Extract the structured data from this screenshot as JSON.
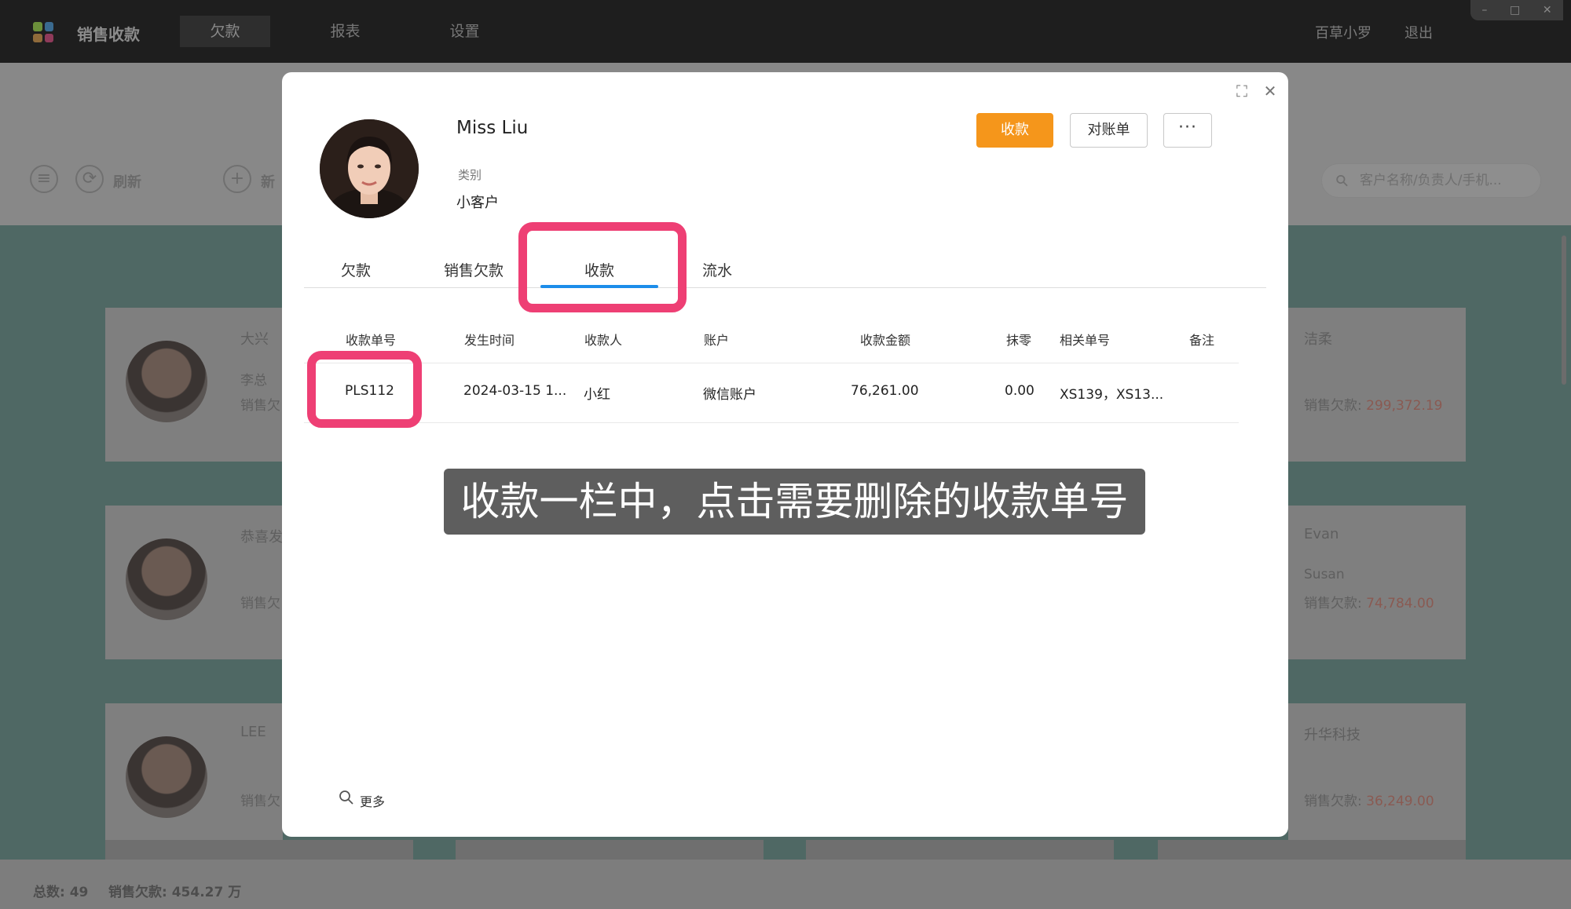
{
  "app": {
    "title": "销售收款",
    "nav": [
      {
        "label": "欠款",
        "active": true
      },
      {
        "label": "报表",
        "active": false
      },
      {
        "label": "设置",
        "active": false
      }
    ],
    "user": "百草小罗",
    "logout": "退出"
  },
  "toolbar": {
    "refresh_label": "刷新",
    "new_label": "新",
    "search_placeholder": "客户名称/负责人/手机..."
  },
  "background_cards": [
    {
      "name": "大兴",
      "line2": "李总",
      "line3": "销售欠"
    },
    {
      "name": "恭喜发",
      "line3": "销售欠"
    },
    {
      "name": "LEE",
      "line3": "销售欠"
    }
  ],
  "background_cards_right": [
    {
      "name": "洁柔",
      "debt_label": "销售欠款:",
      "debt_value": "299,372.19"
    },
    {
      "name": "Evan",
      "line2": "Susan",
      "debt_label": "销售欠款:",
      "debt_value": "74,784.00"
    },
    {
      "name": "升华科技",
      "debt_label": "销售欠款:",
      "debt_value": "36,249.00"
    }
  ],
  "status": {
    "total": "总数:  49",
    "sales_debt": "销售欠款:  454.27 万"
  },
  "modal": {
    "customer_name": "Miss Liu",
    "category_label": "类别",
    "category_value": "小客户",
    "buttons": {
      "collect": "收款",
      "statement": "对账单",
      "more": "···"
    },
    "tabs": [
      {
        "label": "欠款",
        "active": false
      },
      {
        "label": "销售欠款",
        "active": false
      },
      {
        "label": "收款",
        "active": true
      },
      {
        "label": "流水",
        "active": false
      }
    ],
    "table": {
      "headers": [
        "收款单号",
        "发生时间",
        "收款人",
        "账户",
        "收款金额",
        "抹零",
        "相关单号",
        "备注"
      ],
      "rows": [
        [
          "PLS112",
          "2024-03-15 1...",
          "小红",
          "微信账户",
          "76,261.00",
          "0.00",
          "XS139，XS13...",
          ""
        ]
      ]
    },
    "more_link": "更多"
  },
  "caption": "收款一栏中，点击需要删除的收款单号",
  "colors": {
    "accent": "#f5961b",
    "tab_active": "#1c8dea",
    "highlight": "#ee3f74"
  }
}
